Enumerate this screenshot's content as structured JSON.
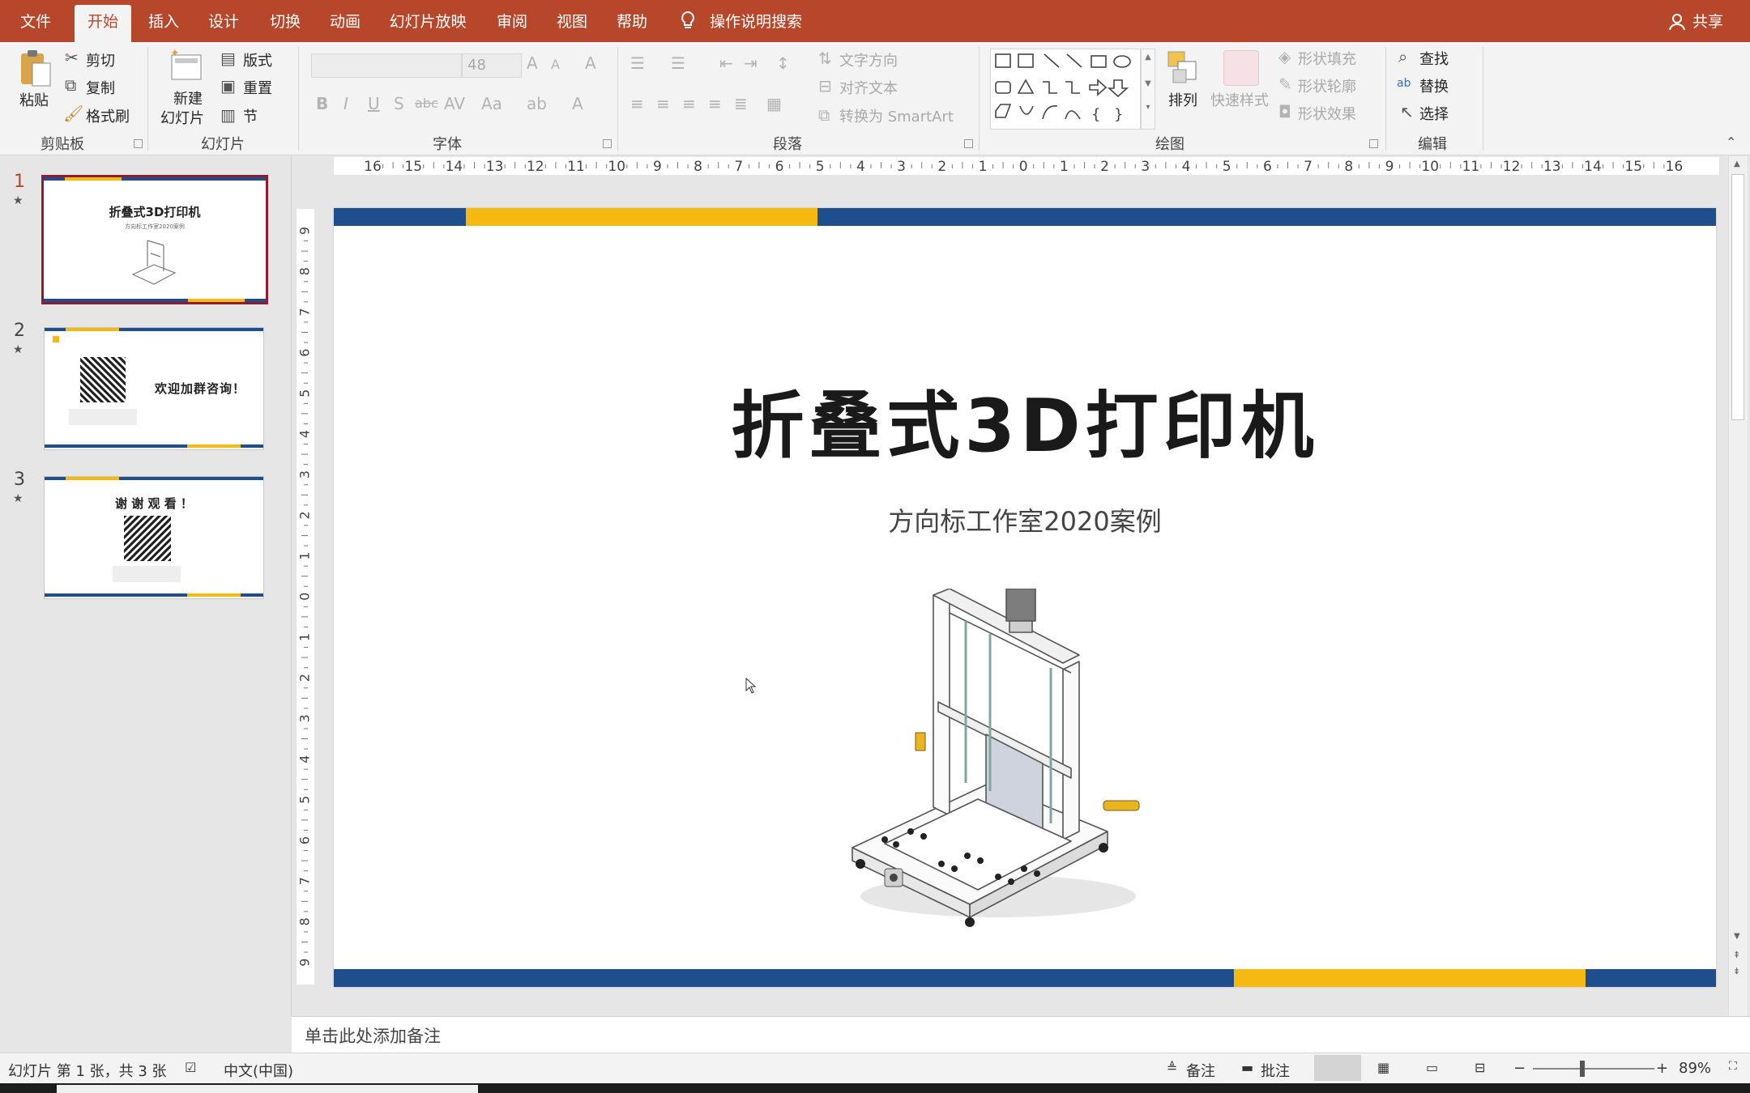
{
  "menu": {
    "file": "文件",
    "tabs": [
      "开始",
      "插入",
      "设计",
      "切换",
      "动画",
      "幻灯片放映",
      "审阅",
      "视图",
      "帮助"
    ],
    "search": "操作说明搜索",
    "share": "共享"
  },
  "ribbon": {
    "clipboard": {
      "paste": "粘贴",
      "cut": "剪切",
      "copy": "复制",
      "format_painter": "格式刷",
      "label": "剪贴板"
    },
    "slides": {
      "new_slide_1": "新建",
      "new_slide_2": "幻灯片",
      "layout": "版式",
      "reset": "重置",
      "section": "节",
      "label": "幻灯片"
    },
    "font": {
      "size": "48",
      "label": "字体"
    },
    "paragraph": {
      "text_direction": "文字方向",
      "align_text": "对齐文本",
      "convert_smartart": "转换为 SmartArt",
      "label": "段落"
    },
    "drawing": {
      "arrange": "排列",
      "quick_styles": "快速样式",
      "shape_fill": "形状填充",
      "shape_outline": "形状轮廓",
      "shape_effects": "形状效果",
      "label": "绘图"
    },
    "editing": {
      "find": "查找",
      "replace": "替换",
      "select": "选择",
      "label": "编辑"
    }
  },
  "thumbnails": [
    {
      "number": "1",
      "title": "折叠式3D打印机",
      "subtitle": "方向标工作室2020案例"
    },
    {
      "number": "2",
      "title": "欢迎加群咨询！"
    },
    {
      "number": "3",
      "title": "谢 谢 观 看 ！"
    }
  ],
  "ruler": {
    "h_ticks": [
      "16",
      "15",
      "14",
      "13",
      "12",
      "11",
      "10",
      "9",
      "8",
      "7",
      "6",
      "5",
      "4",
      "3",
      "2",
      "1",
      "0",
      "1",
      "2",
      "3",
      "4",
      "5",
      "6",
      "7",
      "8",
      "9",
      "10",
      "11",
      "12",
      "13",
      "14",
      "15",
      "16"
    ],
    "v_ticks": [
      "9",
      "8",
      "7",
      "6",
      "5",
      "4",
      "3",
      "2",
      "1",
      "0",
      "1",
      "2",
      "3",
      "4",
      "5",
      "6",
      "7",
      "8",
      "9"
    ]
  },
  "slide": {
    "title": "折叠式3D打印机",
    "subtitle": "方向标工作室2020案例",
    "colors": {
      "navy": "#1f4e8c",
      "gold": "#f6b90f"
    }
  },
  "notes_placeholder": "单击此处添加备注",
  "status": {
    "slide_info": "幻灯片 第 1 张，共 3 张",
    "language": "中文(中国)",
    "notes": "备注",
    "comments": "批注",
    "zoom": "89%"
  }
}
